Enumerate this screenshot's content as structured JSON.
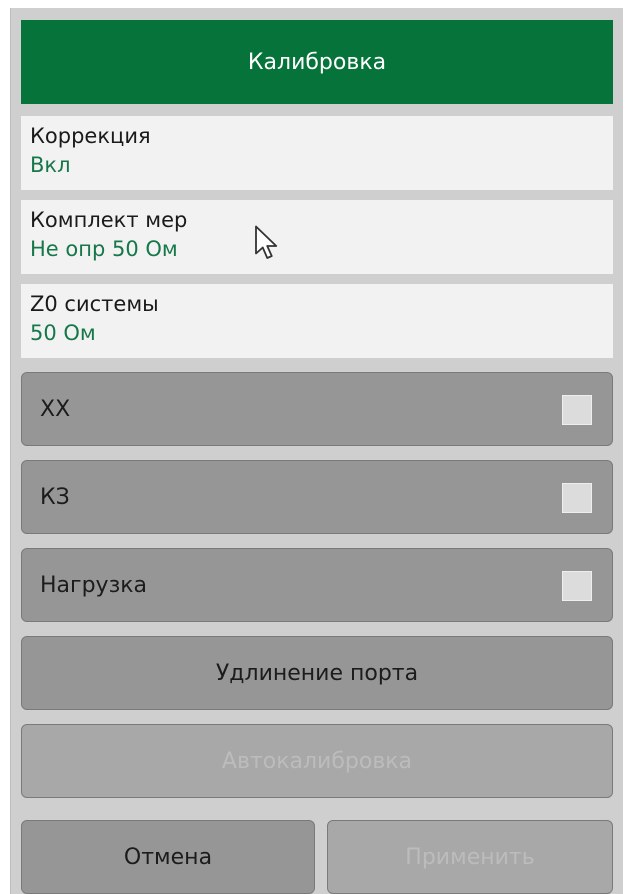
{
  "header": {
    "title": "Калибровка"
  },
  "fields": {
    "correction": {
      "label": "Коррекция",
      "value": "Вкл"
    },
    "cal_kit": {
      "label": "Комплект мер",
      "value": "Не опр 50 Ом"
    },
    "z0": {
      "label": "Z0 системы",
      "value": "50 Ом"
    }
  },
  "standards": {
    "open": {
      "label": "ХХ",
      "checked": false
    },
    "short": {
      "label": "КЗ",
      "checked": false
    },
    "load": {
      "label": "Нагрузка",
      "checked": false
    }
  },
  "buttons": {
    "port_extension": "Удлинение порта",
    "autocal": "Автокалибровка",
    "autocal_enabled": false,
    "cancel": "Отмена",
    "apply": "Применить",
    "apply_enabled": false
  },
  "colors": {
    "header_bg": "#06733a",
    "value_text": "#16784a",
    "button_bg": "#969696",
    "panel_bg": "#cfcfcf"
  },
  "icons": {
    "cursor": "mouse-pointer-arrow"
  }
}
